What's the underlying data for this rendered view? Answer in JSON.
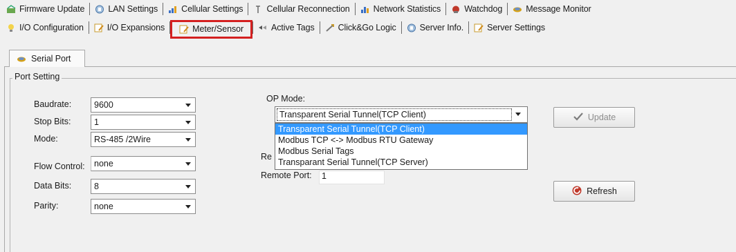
{
  "tabs_row1": [
    {
      "label": "Firmware Update",
      "icon": "firmware-icon"
    },
    {
      "label": "LAN Settings",
      "icon": "lan-icon"
    },
    {
      "label": "Cellular Settings",
      "icon": "cellular-icon"
    },
    {
      "label": "Cellular Reconnection",
      "icon": "reconnect-icon"
    },
    {
      "label": "Network Statistics",
      "icon": "statistics-icon"
    },
    {
      "label": "Watchdog",
      "icon": "watchdog-icon"
    },
    {
      "label": "Message Monitor",
      "icon": "monitor-icon"
    }
  ],
  "tabs_row2": [
    {
      "label": "I/O Configuration",
      "icon": "io-config-icon"
    },
    {
      "label": "I/O Expansions",
      "icon": "io-expansion-icon"
    },
    {
      "label": "Meter/Sensor",
      "icon": "meter-icon"
    },
    {
      "label": "Active Tags",
      "icon": "tags-icon"
    },
    {
      "label": "Click&Go Logic",
      "icon": "logic-icon"
    },
    {
      "label": "Server Info.",
      "icon": "server-info-icon"
    },
    {
      "label": "Server Settings",
      "icon": "server-settings-icon"
    }
  ],
  "selected_tab": "Meter/Sensor",
  "inner_tab": {
    "label": "Serial Port"
  },
  "port_setting": {
    "title": "Port Setting",
    "baudrate": {
      "label": "Baudrate:",
      "value": "9600"
    },
    "stop_bits": {
      "label": "Stop Bits:",
      "value": "1"
    },
    "mode": {
      "label": "Mode:",
      "value": "RS-485 /2Wire"
    },
    "flow_control": {
      "label": "Flow Control:",
      "value": "none"
    },
    "data_bits": {
      "label": "Data Bits:",
      "value": "8"
    },
    "parity": {
      "label": "Parity:",
      "value": "none"
    }
  },
  "op_mode": {
    "label": "OP Mode:",
    "value": "Transparent Serial Tunnel(TCP Client)",
    "options": [
      "Transparent Serial Tunnel(TCP Client)",
      "Modbus TCP <-> Modbus RTU Gateway",
      "Modbus Serial Tags",
      "Transparant Serial Tunnel(TCP Server)"
    ]
  },
  "remote_ip_label_partial": "Re",
  "remote_port": {
    "label": "Remote Port:",
    "value": "1"
  },
  "buttons": {
    "update": "Update",
    "refresh": "Refresh"
  },
  "colors": {
    "selection": "#3399ff",
    "highlight_frame": "#d42020"
  }
}
